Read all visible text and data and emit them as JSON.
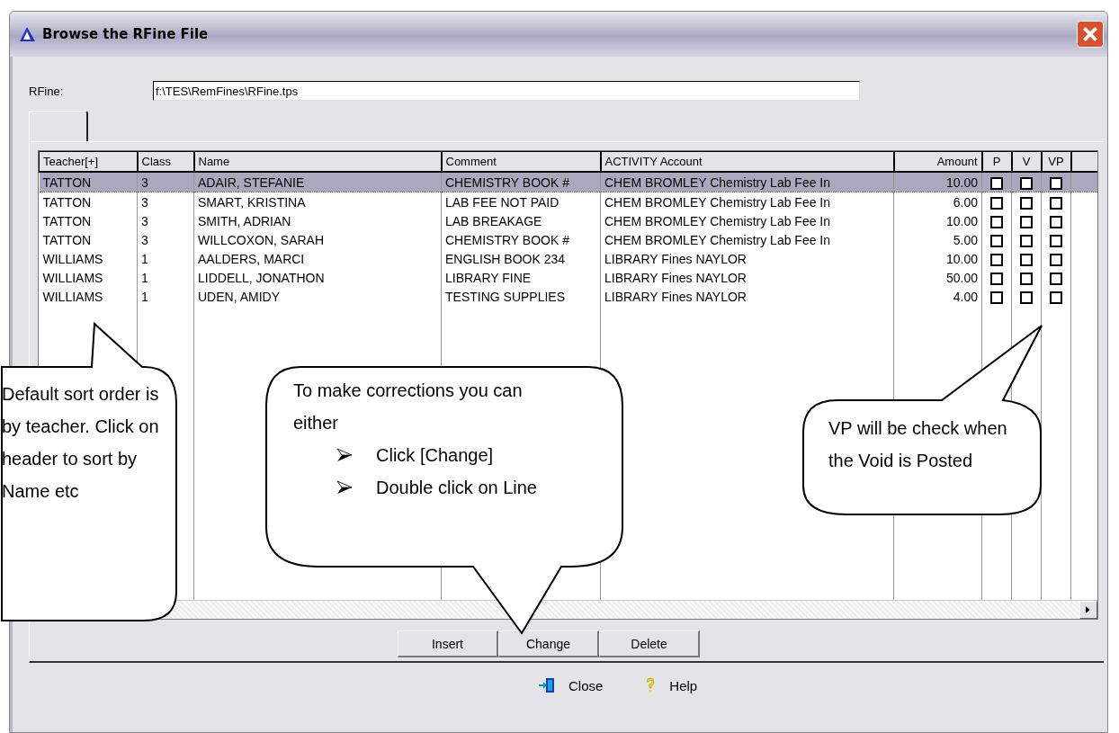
{
  "window": {
    "title": "Browse the RFine File"
  },
  "file_field": {
    "label": "RFine:",
    "value": "f:\\TES\\RemFines\\RFine.tps"
  },
  "table": {
    "columns": [
      {
        "label": "Teacher[+]",
        "kind": "text"
      },
      {
        "label": "Class",
        "kind": "text"
      },
      {
        "label": "Name",
        "kind": "text"
      },
      {
        "label": "Comment",
        "kind": "text"
      },
      {
        "label": "ACTIVITY Account",
        "kind": "text"
      },
      {
        "label": "Amount",
        "kind": "number"
      },
      {
        "label": "P",
        "kind": "flag"
      },
      {
        "label": "V",
        "kind": "flag"
      },
      {
        "label": "VP",
        "kind": "flag"
      }
    ],
    "rows": [
      {
        "selected": true,
        "teacher": "TATTON",
        "class": "3",
        "name": "ADAIR, STEFANIE",
        "comment": "CHEMISTRY BOOK #",
        "account": "CHEM BROMLEY Chemistry Lab Fee In",
        "amount": "10.00",
        "p": false,
        "v": false,
        "vp": false
      },
      {
        "selected": false,
        "teacher": "TATTON",
        "class": "3",
        "name": "SMART, KRISTINA",
        "comment": "LAB FEE NOT PAID",
        "account": "CHEM BROMLEY Chemistry Lab Fee In",
        "amount": "6.00",
        "p": false,
        "v": false,
        "vp": false
      },
      {
        "selected": false,
        "teacher": "TATTON",
        "class": "3",
        "name": "SMITH, ADRIAN",
        "comment": "LAB BREAKAGE",
        "account": "CHEM BROMLEY Chemistry Lab Fee In",
        "amount": "10.00",
        "p": false,
        "v": false,
        "vp": false
      },
      {
        "selected": false,
        "teacher": "TATTON",
        "class": "3",
        "name": "WILLCOXON, SARAH",
        "comment": "CHEMISTRY BOOK #",
        "account": "CHEM BROMLEY Chemistry Lab Fee In",
        "amount": "5.00",
        "p": false,
        "v": false,
        "vp": false
      },
      {
        "selected": false,
        "teacher": "WILLIAMS",
        "class": "1",
        "name": "AALDERS, MARCI",
        "comment": "ENGLISH BOOK 234",
        "account": "LIBRARY Fines NAYLOR",
        "amount": "10.00",
        "p": false,
        "v": false,
        "vp": false
      },
      {
        "selected": false,
        "teacher": "WILLIAMS",
        "class": "1",
        "name": "LIDDELL, JONATHON",
        "comment": "LIBRARY FINE",
        "account": "LIBRARY Fines NAYLOR",
        "amount": "50.00",
        "p": false,
        "v": false,
        "vp": false
      },
      {
        "selected": false,
        "teacher": "WILLIAMS",
        "class": "1",
        "name": "UDEN, AMIDY",
        "comment": "TESTING SUPPLIES",
        "account": "LIBRARY Fines NAYLOR",
        "amount": "4.00",
        "p": false,
        "v": false,
        "vp": false
      }
    ]
  },
  "buttons": [
    "Insert",
    "Change",
    "Delete"
  ],
  "footer_buttons": [
    {
      "label": "Close",
      "kind": "exit"
    },
    {
      "label": "Help",
      "kind": "help"
    }
  ],
  "callouts": [
    {
      "kind": "left",
      "text": "Default sort order is by teacher.   Click on header to sort by Name etc"
    },
    {
      "kind": "middle",
      "text": "To make corrections you can either",
      "bullets": [
        "Click [Change]",
        "Double click on Line"
      ]
    },
    {
      "kind": "right",
      "text": "VP will be check when the Void is Posted"
    }
  ]
}
